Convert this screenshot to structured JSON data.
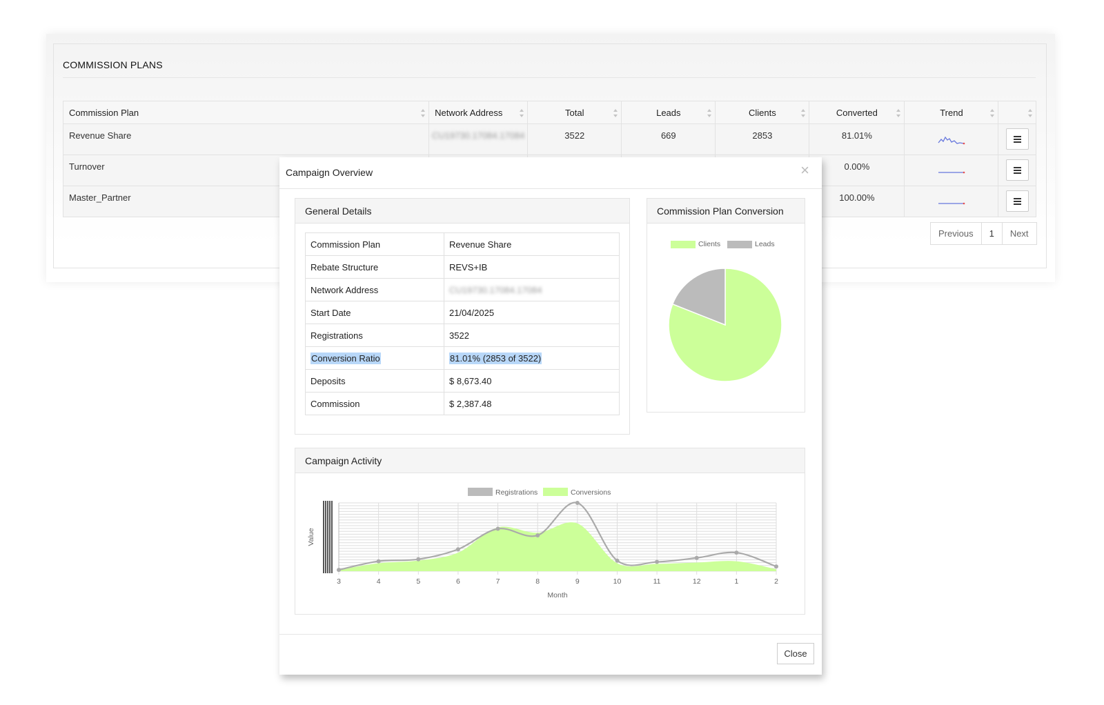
{
  "page": {
    "title": "COMMISSION PLANS",
    "table": {
      "headers": [
        "Commission Plan",
        "Network Address",
        "Total",
        "Leads",
        "Clients",
        "Converted",
        "Trend",
        ""
      ],
      "rows": [
        {
          "plan": "Revenue Share",
          "address": "CU19730.17084.17084",
          "total": "3522",
          "leads": "669",
          "clients": "2853",
          "converted": "81.01%"
        },
        {
          "plan": "Turnover",
          "address": "",
          "total": "",
          "leads": "",
          "clients": "",
          "converted": "0.00%"
        },
        {
          "plan": "Master_Partner",
          "address": "",
          "total": "",
          "leads": "",
          "clients": "",
          "converted": "100.00%"
        }
      ]
    },
    "pager": {
      "previous": "Previous",
      "current": "1",
      "next": "Next"
    }
  },
  "modal": {
    "title": "Campaign Overview",
    "close_icon": "close-icon",
    "close_label": "Close",
    "general": {
      "title": "General Details",
      "rows": [
        {
          "label": "Commission Plan",
          "value": "Revenue Share"
        },
        {
          "label": "Rebate Structure",
          "value": "REVS+IB"
        },
        {
          "label": "Network Address",
          "value": "CU19730.17084.17084"
        },
        {
          "label": "Start Date",
          "value": "21/04/2025"
        },
        {
          "label": "Registrations",
          "value": "3522"
        },
        {
          "label": "Conversion Ratio",
          "value": "81.01% (2853 of 3522)"
        },
        {
          "label": "Deposits",
          "value": "$ 8,673.40"
        },
        {
          "label": "Commission",
          "value": "$ 2,387.48"
        }
      ]
    },
    "pie": {
      "title": "Commission Plan Conversion"
    },
    "activity": {
      "title": "Campaign Activity"
    }
  },
  "colors": {
    "clients": "#ccff99",
    "leads": "#bbbbbb",
    "line": "#aaaaaa",
    "highlight": "#b8d7f8"
  },
  "chart_data": [
    {
      "type": "pie",
      "legend": [
        "Clients",
        "Leads"
      ],
      "series": [
        {
          "name": "Clients",
          "value": 2853
        },
        {
          "name": "Leads",
          "value": 669
        }
      ],
      "legend_position": "top"
    },
    {
      "type": "area",
      "xlabel": "Month",
      "ylabel": "Value",
      "categories": [
        "3",
        "4",
        "5",
        "6",
        "7",
        "8",
        "9",
        "10",
        "11",
        "12",
        "1",
        "2"
      ],
      "legend": [
        "Registrations",
        "Conversions"
      ],
      "series": [
        {
          "name": "Registrations",
          "values": [
            2,
            15,
            18,
            33,
            64,
            54,
            103,
            16,
            14,
            20,
            28,
            7
          ]
        },
        {
          "name": "Conversions",
          "values": [
            2,
            12,
            16,
            28,
            66,
            58,
            72,
            12,
            11,
            13,
            15,
            3
          ]
        }
      ],
      "ylim": [
        0,
        103
      ],
      "grid": true,
      "legend_position": "top"
    }
  ]
}
